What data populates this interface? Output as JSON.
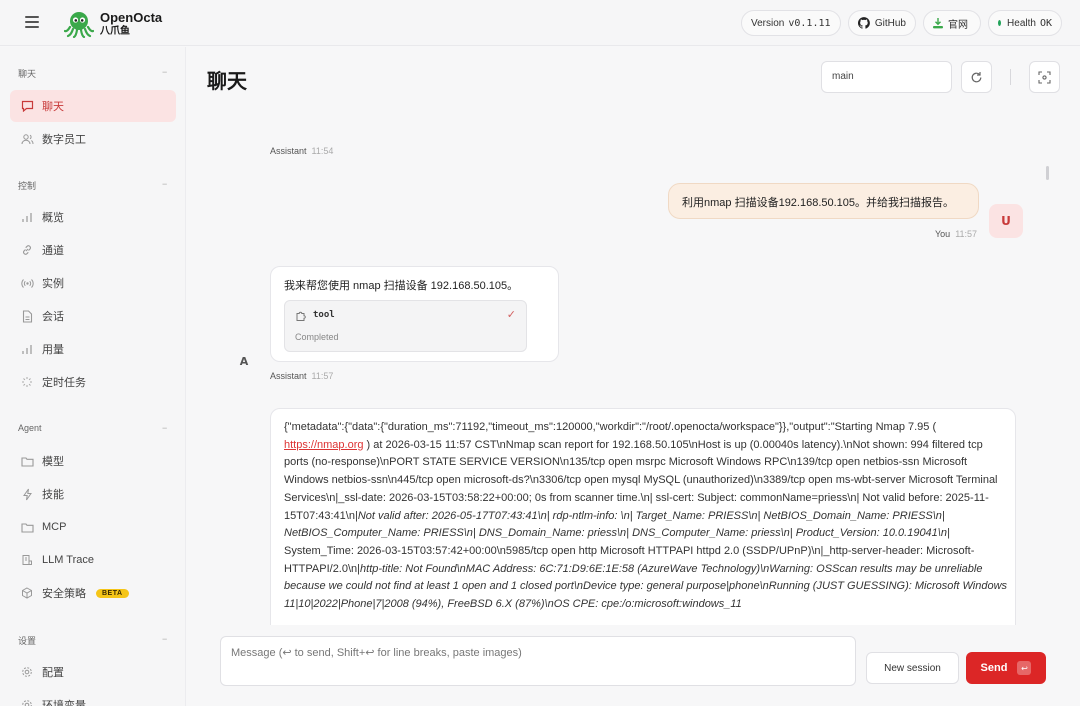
{
  "app": {
    "name": "OpenOcta",
    "subtitle": "八爪鱼"
  },
  "header": {
    "version_label": "Version",
    "version_value": "v0.1.11",
    "github_label": "GitHub",
    "website_label": "官网",
    "health_label": "Health",
    "health_value": "OK"
  },
  "sidebar": {
    "sections": [
      {
        "title": "聊天",
        "items": [
          {
            "label": "聊天",
            "icon": "chat-bubble-icon",
            "active": true
          },
          {
            "label": "数字员工",
            "icon": "users-icon"
          }
        ]
      },
      {
        "title": "控制",
        "items": [
          {
            "label": "概览",
            "icon": "bar-chart-icon"
          },
          {
            "label": "通道",
            "icon": "link-icon"
          },
          {
            "label": "实例",
            "icon": "broadcast-icon"
          },
          {
            "label": "会话",
            "icon": "document-icon"
          },
          {
            "label": "用量",
            "icon": "bar-chart-icon"
          },
          {
            "label": "定时任务",
            "icon": "loader-icon"
          }
        ]
      },
      {
        "title": "Agent",
        "items": [
          {
            "label": "模型",
            "icon": "folder-icon"
          },
          {
            "label": "技能",
            "icon": "bolt-icon"
          },
          {
            "label": "MCP",
            "icon": "folder-icon"
          },
          {
            "label": "LLM Trace",
            "icon": "trace-icon"
          },
          {
            "label": "安全策略",
            "icon": "cube-icon",
            "badge": "BETA"
          }
        ]
      },
      {
        "title": "设置",
        "items": [
          {
            "label": "配置",
            "icon": "gear-icon"
          },
          {
            "label": "环境变量",
            "icon": "gear-icon"
          }
        ]
      }
    ],
    "collapse_glyph": "−"
  },
  "main": {
    "title": "聊天",
    "session_value": "main",
    "messages": {
      "assistant_top": {
        "role": "Assistant",
        "time": "11:54"
      },
      "user": {
        "text": "利用nmap 扫描设备192.168.50.105。并给我扫描报告。",
        "role": "You",
        "time": "11:57",
        "avatar": "U"
      },
      "assistant_tool": {
        "text": "我来帮您使用 nmap 扫描设备 192.168.50.105。",
        "tool_name": "tool",
        "tool_status": "Completed",
        "role": "Assistant",
        "time": "11:57",
        "avatar": "A"
      },
      "output": {
        "p1": "{\"metadata\":{\"data\":{\"duration_ms\":71192,\"timeout_ms\":120000,\"workdir\":\"/root/.openocta/workspace\"}},\"output\":\"Starting Nmap 7.95 ( ",
        "link": "https://nmap.org",
        "p2": " ) at 2026-03-15 11:57 CST\\nNmap scan report for 192.168.50.105\\nHost is up (0.00040s latency).\\nNot shown: 994 filtered tcp ports (no-response)\\nPORT STATE SERVICE VERSION\\n135/tcp open msrpc Microsoft Windows RPC\\n139/tcp open netbios-ssn Microsoft Windows netbios-ssn\\n445/tcp open microsoft-ds?\\n3306/tcp open mysql MySQL (unauthorized)\\n3389/tcp open ms-wbt-server Microsoft Terminal Services\\n|_ssl-date: 2026-03-15T03:58:22+00:00; 0s from scanner time.\\n| ssl-cert: Subject: commonName=priess\\n| Not valid before: 2025-11-15T07:43:41\\n|",
        "i1": "Not valid after: 2026-05-17T07:43:41\\n| rdp-ntlm-info: \\n| Target_Name: PRIESS\\n| NetBIOS_Domain_Name: PRIESS\\n| NetBIOS_Computer_Name: PRIESS\\n| DNS_Domain_Name: priess\\n| DNS_Computer_Name: priess\\n| Product_Version: 10.0.19041\\n|",
        "p3": " System_Time: 2026-03-15T03:57:42+00:00\\n5985/tcp open http Microsoft HTTPAPI httpd 2.0 (SSDP/UPnP)\\n|_http-server-header: Microsoft-HTTPAPI/2.0\\n|",
        "i2": "http-title: Not Found\\nMAC Address: 6C:71:D9:6E:1E:58 (AzureWave Technology)\\nWarning: OSScan results may be unreliable because we could not find at least 1 open and 1 closed port\\nDevice type: general purpose|phone\\nRunning (JUST GUESSING): Microsoft Windows 11|10|2022|Phone|7|2008 (94%), FreeBSD 6.X (87%)\\nOS CPE: cpe:/o:microsoft:windows_11"
      }
    },
    "composer": {
      "placeholder": "Message (↩ to send, Shift+↩ for line breaks, paste images)",
      "new_session_label": "New session",
      "send_label": "Send",
      "send_key": "↩"
    }
  },
  "colors": {
    "accent": "#dc2626",
    "active_bg": "#fbe3e3",
    "user_bubble": "#fbeee2",
    "health_dot": "#22a35a",
    "beta": "#f5c518"
  }
}
